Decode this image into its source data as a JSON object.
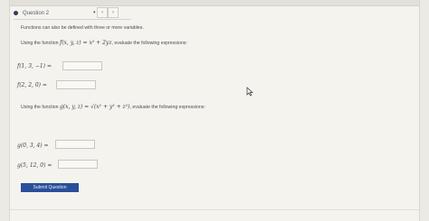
{
  "question": {
    "title": "Question 2"
  },
  "nav": {
    "prev": "‹",
    "next": "›",
    "dropdown": "▾"
  },
  "intro": "Functions can also be defined with three or more variables.",
  "part1": {
    "prefix": "Using the function ",
    "func": "f(x, y, z) = x² + 2yz",
    "suffix": ", evaluate the following expressions:",
    "q1": "f(1, 3, −1) =",
    "q2": "f(2, 2, 0) ="
  },
  "part2": {
    "prefix": "Using the function ",
    "func": "g(x, y, z) = √(x² + y² + z²)",
    "suffix": ", evaluate the following expressions:",
    "q1": "g(0, 3, 4) =",
    "q2": "g(5, 12, 0) ="
  },
  "submit": "Submit Question"
}
